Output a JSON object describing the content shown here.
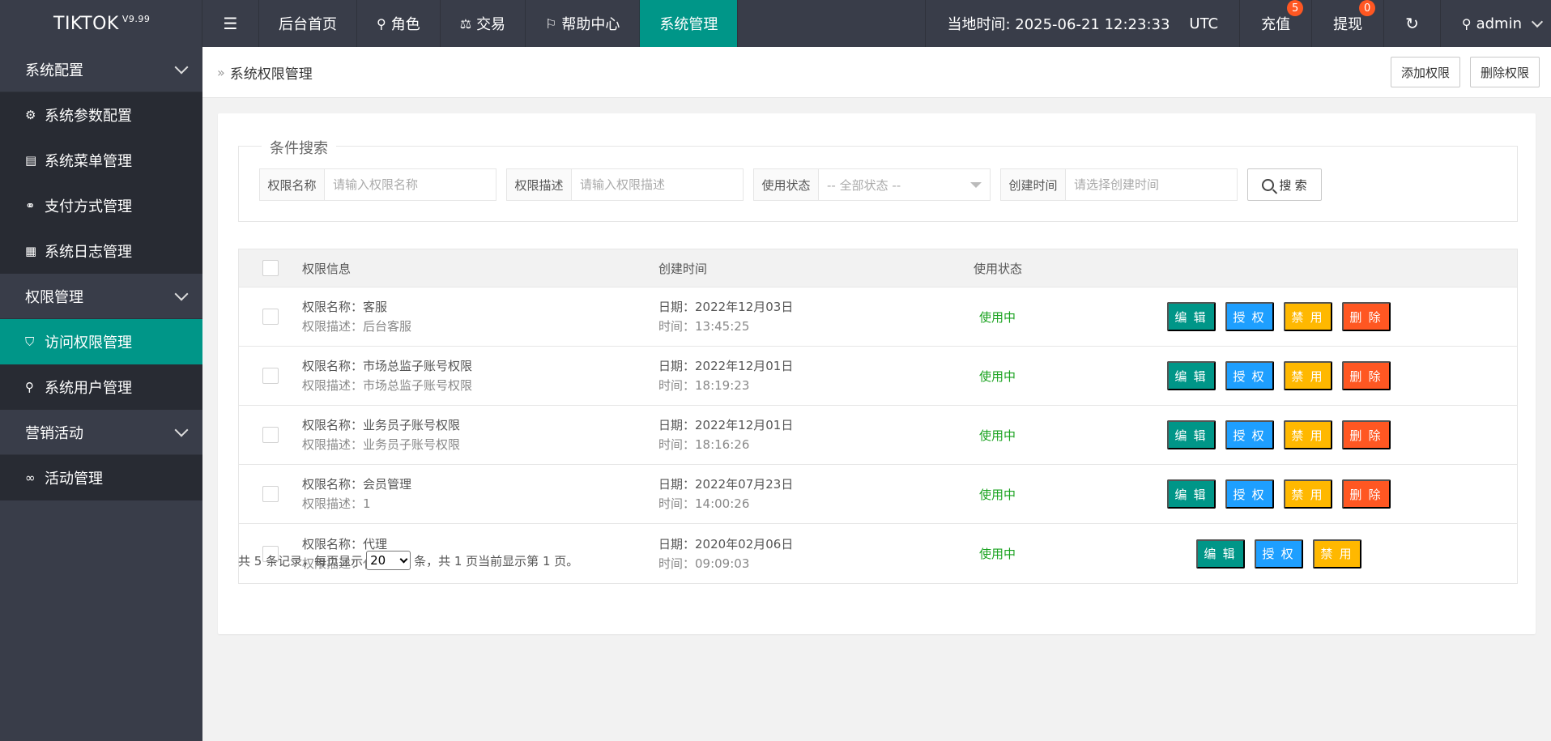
{
  "topbar": {
    "logo": "TIKTOK",
    "version": "V9.99",
    "menu_icon": "hamburger-icon",
    "nav": [
      {
        "label": "后台首页",
        "icon": ""
      },
      {
        "label": "角色",
        "icon": "user-icon"
      },
      {
        "label": "交易",
        "icon": "scale-icon"
      },
      {
        "label": "帮助中心",
        "icon": "flag-icon"
      },
      {
        "label": "系统管理",
        "icon": "",
        "active": true
      }
    ],
    "time_label": "当地时间: 2025-06-21 12:23:33",
    "timezone": "UTC",
    "recharge": {
      "label": "充值",
      "badge": "5"
    },
    "withdraw": {
      "label": "提现",
      "badge": "0"
    },
    "refresh_icon": "refresh-icon",
    "user": "admin"
  },
  "sidebar": {
    "groups": [
      {
        "label": "系统配置",
        "items": [
          {
            "label": "系统参数配置",
            "icon": "gear-icon"
          },
          {
            "label": "系统菜单管理",
            "icon": "window-icon"
          },
          {
            "label": "支付方式管理",
            "icon": "link-icon"
          },
          {
            "label": "系统日志管理",
            "icon": "clipboard-icon"
          }
        ]
      },
      {
        "label": "权限管理",
        "items": [
          {
            "label": "访问权限管理",
            "icon": "shield-icon",
            "active": true
          },
          {
            "label": "系统用户管理",
            "icon": "user-icon"
          }
        ]
      },
      {
        "label": "营销活动",
        "items": [
          {
            "label": "活动管理",
            "icon": "infinity-icon"
          }
        ]
      }
    ]
  },
  "breadcrumb": {
    "title": "系统权限管理",
    "add_label": "添加权限",
    "delete_label": "删除权限"
  },
  "search": {
    "legend": "条件搜索",
    "name_label": "权限名称",
    "name_placeholder": "请输入权限名称",
    "desc_label": "权限描述",
    "desc_placeholder": "请输入权限描述",
    "status_label": "使用状态",
    "status_value": "-- 全部状态 --",
    "created_label": "创建时间",
    "created_placeholder": "请选择创建时间",
    "button": "搜 索"
  },
  "table": {
    "headers": {
      "info": "权限信息",
      "created": "创建时间",
      "status": "使用状态"
    },
    "rows": [
      {
        "name": "权限名称：客服",
        "desc": "权限描述：后台客服",
        "date": "日期：2022年12月03日",
        "time": "时间：13:45:25",
        "status": "使用中",
        "ops": [
          "编 辑",
          "授 权",
          "禁 用",
          "删 除"
        ]
      },
      {
        "name": "权限名称：市场总监子账号权限",
        "desc": "权限描述：市场总监子账号权限",
        "date": "日期：2022年12月01日",
        "time": "时间：18:19:23",
        "status": "使用中",
        "ops": [
          "编 辑",
          "授 权",
          "禁 用",
          "删 除"
        ]
      },
      {
        "name": "权限名称：业务员子账号权限",
        "desc": "权限描述：业务员子账号权限",
        "date": "日期：2022年12月01日",
        "time": "时间：18:16:26",
        "status": "使用中",
        "ops": [
          "编 辑",
          "授 权",
          "禁 用",
          "删 除"
        ]
      },
      {
        "name": "权限名称：会员管理",
        "desc": "权限描述：1",
        "date": "日期：2022年07月23日",
        "time": "时间：14:00:26",
        "status": "使用中",
        "ops": [
          "编 辑",
          "授 权",
          "禁 用",
          "删 除"
        ]
      },
      {
        "name": "权限名称：代理",
        "desc": "权限描述：代理",
        "date": "日期：2020年02月06日",
        "time": "时间：09:09:03",
        "status": "使用中",
        "ops": [
          "编 辑",
          "授 权",
          "禁 用"
        ]
      }
    ]
  },
  "pager": {
    "prefix": "共 5 条记录，每页显示",
    "page_size": "20",
    "suffix": "条，共 1 页当前显示第 1 页。"
  },
  "colors": {
    "topbar": "#393d49",
    "accent": "#009688",
    "blue": "#1e9fff",
    "yellow": "#ffb800",
    "red": "#ff5722",
    "status_green": "#19a21f"
  }
}
